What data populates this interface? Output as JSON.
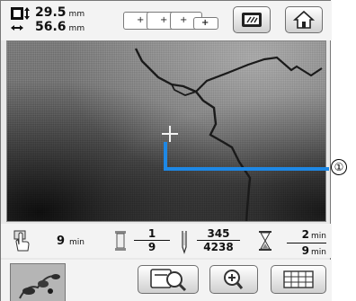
{
  "header": {
    "size_height_value": "29.5",
    "size_width_value": "56.6",
    "size_unit": "mm",
    "icons": {
      "size": "pattern-size-icon",
      "scale_small": "size-plus-small-icon",
      "scale_medium": "size-plus-medium-icon",
      "scale_large": "size-plus-large-icon",
      "scale_xlarge": "size-plus-xlarge-icon",
      "stitch": "stitch-tension-icon",
      "home": "home-icon"
    }
  },
  "status": {
    "time_value": "9",
    "time_unit": "min",
    "color_current": "1",
    "color_total": "9",
    "stitch_current": "345",
    "stitch_total": "4238",
    "remaining_time": "2",
    "remaining_unit": "min",
    "total_time": "9",
    "total_unit": "min",
    "icons": {
      "time": "hand-time-icon",
      "spool": "thread-spool-icon",
      "needle": "needle-icon",
      "hourglass": "hourglass-icon"
    }
  },
  "callout": {
    "marker": "①"
  },
  "bottom": {
    "icons": {
      "thumbnail": "pattern-thumbnail-icon",
      "camera_zoom": "camera-magnify-icon",
      "zoom": "zoom-icon",
      "grid": "grid-icon"
    }
  },
  "colors": {
    "accent_callout": "#1e88e5",
    "bar_background": "#f3f3f3",
    "button_border": "#6f6f6f"
  }
}
